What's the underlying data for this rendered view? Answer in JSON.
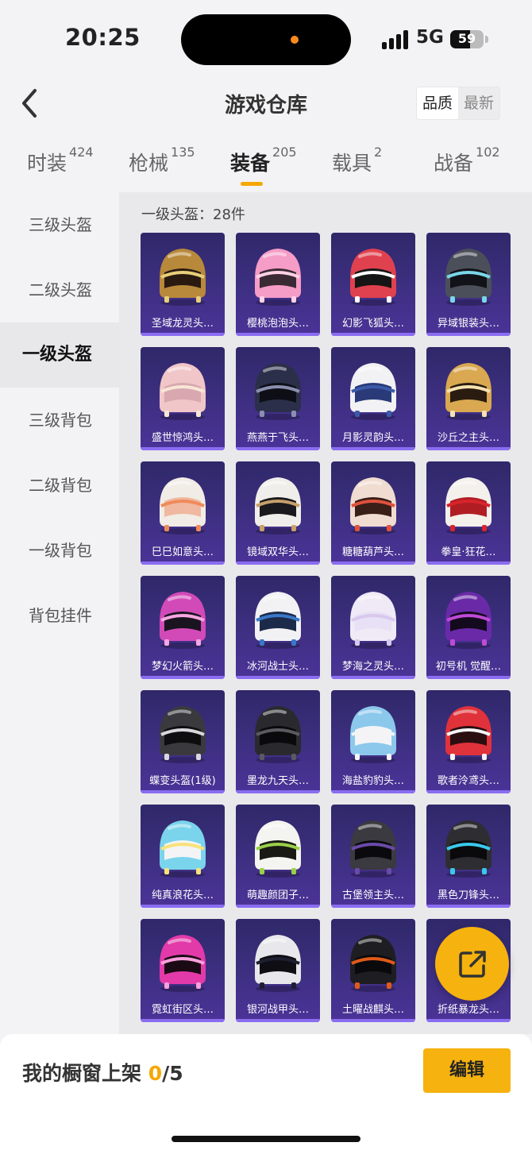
{
  "status_bar": {
    "time": "20:25",
    "network": "5G",
    "battery": "59"
  },
  "nav": {
    "title": "游戏仓库",
    "sort_options": [
      "品质",
      "最新"
    ],
    "active_sort": 0
  },
  "tabs": [
    {
      "label": "时装",
      "count": "424"
    },
    {
      "label": "枪械",
      "count": "135"
    },
    {
      "label": "装备",
      "count": "205"
    },
    {
      "label": "载具",
      "count": "2"
    },
    {
      "label": "战备",
      "count": "102"
    }
  ],
  "active_tab": 2,
  "sidebar": {
    "items": [
      "三级头盔",
      "二级头盔",
      "一级头盔",
      "三级背包",
      "二级背包",
      "一级背包",
      "背包挂件"
    ],
    "active": 2
  },
  "content": {
    "count_label": "一级头盔：28件",
    "items": [
      {
        "name": "圣域龙灵头…",
        "shell": "#b8893a",
        "trim": "#e8cf7a",
        "visor": "#2a1a10",
        "icon": "golden-dragon-helmet-icon"
      },
      {
        "name": "樱桃泡泡头…",
        "shell": "#f59cc7",
        "trim": "#ffd1e6",
        "visor": "#3a2a33",
        "icon": "pink-bubble-helmet-icon"
      },
      {
        "name": "幻影飞狐头…",
        "shell": "#e0414e",
        "trim": "#ffffff",
        "visor": "#151515",
        "icon": "red-fox-helmet-icon"
      },
      {
        "name": "异域银装头…",
        "shell": "#4b4f5a",
        "trim": "#7ad6e8",
        "visor": "#111318",
        "icon": "silver-exotic-helmet-icon"
      },
      {
        "name": "盛世惊鸿头…",
        "shell": "#f1c6c8",
        "trim": "#f7e6d5",
        "visor": "#d8a7b0",
        "icon": "pink-crane-helmet-icon"
      },
      {
        "name": "燕燕于飞头…",
        "shell": "#2b2f4a",
        "trim": "#8a8fb0",
        "visor": "#0e0e16",
        "icon": "swallow-helmet-icon"
      },
      {
        "name": "月影灵韵头…",
        "shell": "#f2f2f4",
        "trim": "#3b5aa8",
        "visor": "#2a3a78",
        "icon": "moon-shadow-helmet-icon"
      },
      {
        "name": "沙丘之主头…",
        "shell": "#d9a850",
        "trim": "#f5e2b0",
        "visor": "#2a1c10",
        "icon": "dune-lord-helmet-icon"
      },
      {
        "name": "巳巳如意头…",
        "shell": "#f1ece6",
        "trim": "#f08a5a",
        "visor": "#f0b8a0",
        "icon": "ruyi-helmet-icon"
      },
      {
        "name": "镜域双华头…",
        "shell": "#f0eeea",
        "trim": "#c7a06a",
        "visor": "#1a1a1e",
        "icon": "mirror-realm-helmet-icon"
      },
      {
        "name": "糖糖葫芦头…",
        "shell": "#f0dcd0",
        "trim": "#e0523c",
        "visor": "#3a1e18",
        "icon": "candy-gourd-helmet-icon"
      },
      {
        "name": "拳皇·狂花…",
        "shell": "#f4f0ec",
        "trim": "#d8242c",
        "visor": "#b01e24",
        "icon": "kof-helmet-icon"
      },
      {
        "name": "梦幻火箭头…",
        "shell": "#d24ab8",
        "trim": "#f6a6e0",
        "visor": "#1a1420",
        "icon": "dream-rocket-helmet-icon"
      },
      {
        "name": "冰河战士头…",
        "shell": "#f2f2f4",
        "trim": "#3a78c8",
        "visor": "#1c2a4a",
        "icon": "glacier-warrior-helmet-icon"
      },
      {
        "name": "梦海之灵头…",
        "shell": "#efeaf6",
        "trim": "#d8c8ee",
        "visor": "#e8e0f4",
        "icon": "dream-sea-helmet-icon"
      },
      {
        "name": "初号机 觉醒…",
        "shell": "#6a2aa8",
        "trim": "#c04ad8",
        "visor": "#140a1e",
        "icon": "eva-unit01-helmet-icon"
      },
      {
        "name": "蝶变头盔(1级)",
        "shell": "#3a3a3e",
        "trim": "#d8d8dc",
        "visor": "#0e0e10",
        "icon": "butterfly-helmet-icon"
      },
      {
        "name": "墨龙九天头…",
        "shell": "#2a2a2e",
        "trim": "#5a5a60",
        "visor": "#0a0a0c",
        "icon": "ink-dragon-helmet-icon"
      },
      {
        "name": "海盐豹豹头…",
        "shell": "#8cc8ec",
        "trim": "#f4f4f6",
        "visor": "#f4f4f6",
        "icon": "sea-salt-leopard-helmet-icon"
      },
      {
        "name": "歌者泠鸢头…",
        "shell": "#e0323a",
        "trim": "#f4f4f6",
        "visor": "#2a0e10",
        "icon": "singer-helmet-icon"
      },
      {
        "name": "纯真浪花头…",
        "shell": "#7ad4ec",
        "trim": "#f8e27a",
        "visor": "#f4f4f6",
        "icon": "wave-helmet-icon"
      },
      {
        "name": "萌趣颜团子…",
        "shell": "#f4f4f0",
        "trim": "#9ad04a",
        "visor": "#1a1a14",
        "icon": "cute-dumpling-helmet-icon"
      },
      {
        "name": "古堡领主头…",
        "shell": "#3a3a40",
        "trim": "#6a4aa8",
        "visor": "#0a0a0e",
        "icon": "castle-lord-helmet-icon"
      },
      {
        "name": "黑色刀锋头…",
        "shell": "#2e2e32",
        "trim": "#3ac8ec",
        "visor": "#0a0a0c",
        "icon": "black-blade-helmet-icon"
      },
      {
        "name": "霓虹街区头…",
        "shell": "#e23aa8",
        "trim": "#f8a0dc",
        "visor": "#1a0a14",
        "icon": "neon-street-helmet-icon"
      },
      {
        "name": "银河战甲头…",
        "shell": "#e8e8ec",
        "trim": "#1e2030",
        "visor": "#0e0e14",
        "icon": "galaxy-armor-helmet-icon"
      },
      {
        "name": "土曜战麒头…",
        "shell": "#1e1e22",
        "trim": "#e05a1a",
        "visor": "#0a0a0c",
        "icon": "saturn-qilin-helmet-icon"
      },
      {
        "name": "折纸暴龙头…",
        "shell": "#3a3a40",
        "trim": "#9a9aa0",
        "visor": "#0a0a0c",
        "icon": "origami-trex-helmet-icon"
      }
    ]
  },
  "footer": {
    "shelf_label": "我的橱窗上架",
    "shelf_current": "0",
    "shelf_total": "/5",
    "edit_label": "编辑"
  },
  "colors": {
    "accent": "#f6b20e",
    "card_bg": "#3d2f80"
  }
}
